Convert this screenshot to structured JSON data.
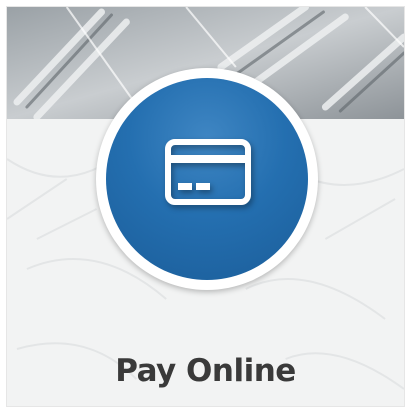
{
  "tile": {
    "label": "Pay Online",
    "icon": "credit-card-icon"
  },
  "colors": {
    "circle_blue": "#246fb0",
    "circle_border": "#ffffff",
    "label_text": "#3a3a3a",
    "card_icon": "#ffffff"
  }
}
